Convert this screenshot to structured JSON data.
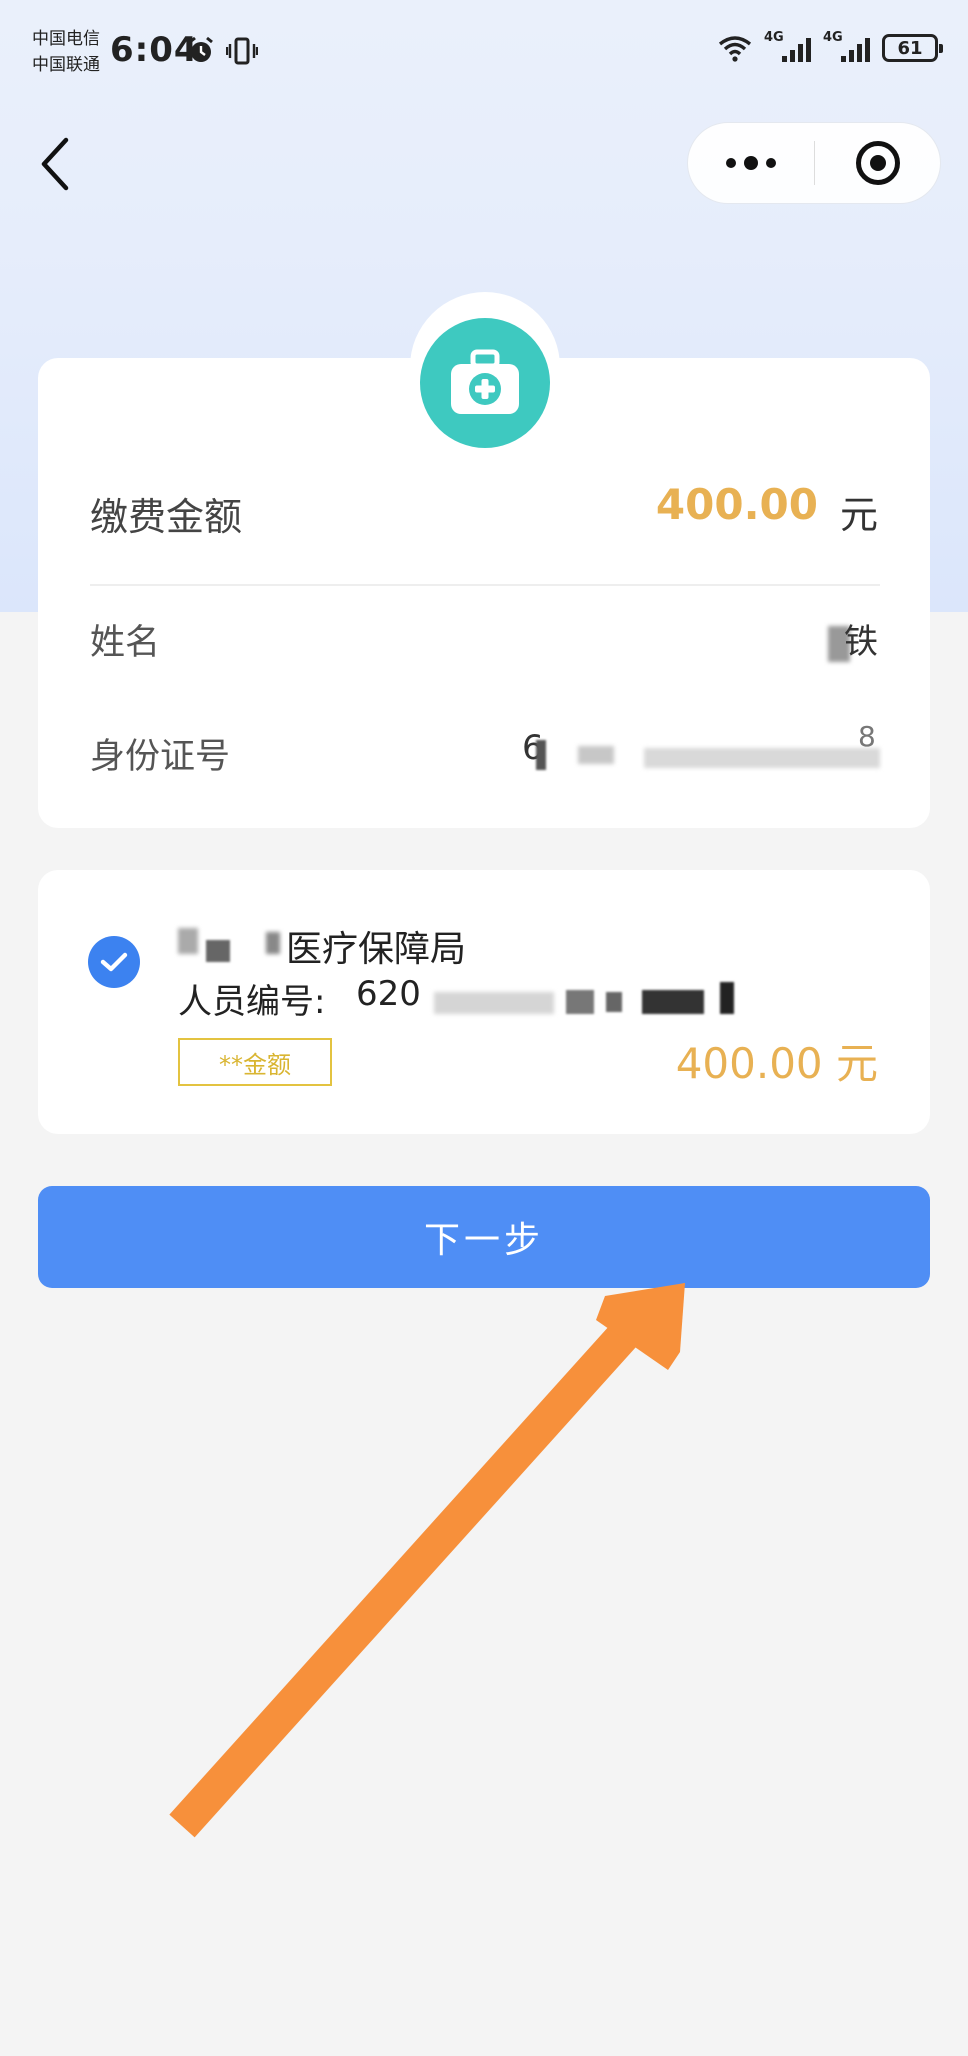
{
  "status_bar": {
    "carrier_1": "中国电信",
    "carrier_2": "中国联通",
    "time": "6:04",
    "net_1": "4G",
    "net_2": "4G",
    "battery": "61"
  },
  "payment": {
    "amount_label": "缴费金额",
    "amount_value": "400.00",
    "amount_unit": "元",
    "name_label": "姓名",
    "name_value_visible": "铁",
    "id_label": "身份证号",
    "id_prefix_visible": "6",
    "id_suffix_visible": "8"
  },
  "selection": {
    "org_name_suffix": "医疗保障局",
    "person_no_label": "人员编号:",
    "person_no_prefix": "620",
    "tag": "**金额",
    "amount": "400.00 元"
  },
  "next_button": {
    "label": "下一步"
  },
  "colors": {
    "accent_blue": "#4f8ef5",
    "amount_gold": "#e8b153",
    "badge_teal": "#3ec9c0",
    "annotation_arrow": "#f7903b"
  },
  "icons": [
    "back-icon",
    "more-icon",
    "target-icon",
    "medical-kit-icon",
    "check-icon",
    "annotation-arrow"
  ]
}
